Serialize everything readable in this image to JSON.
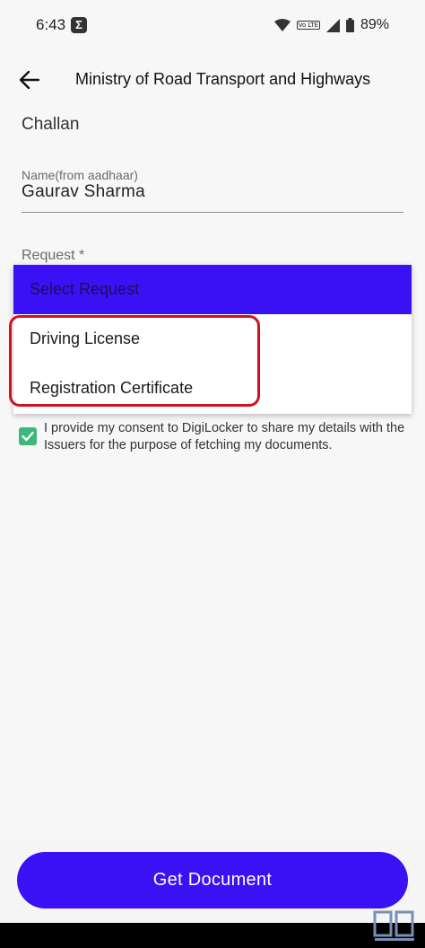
{
  "status_bar": {
    "time": "6:43",
    "app_icon_letter": "Σ",
    "network": "Vo LTE",
    "battery": "89%"
  },
  "header": {
    "title": "Ministry of Road Transport and Highways",
    "back_icon": "arrow-left-icon"
  },
  "form": {
    "section_title": "Challan",
    "name_label": "Name(from aadhaar)",
    "name_value": "Gaurav Sharma",
    "request_label": "Request *"
  },
  "dropdown": {
    "selected": "Select Request",
    "options": [
      {
        "label": "Driving License"
      },
      {
        "label": "Registration Certificate"
      }
    ]
  },
  "consent": {
    "checked": true,
    "text": "I provide my consent to DigiLocker to share my details with the Issuers for the purpose of fetching my documents."
  },
  "footer": {
    "button_label": "Get Document"
  },
  "colors": {
    "accent": "#3a10f5",
    "highlight": "#d0121f",
    "checkbox": "#3db87a"
  }
}
